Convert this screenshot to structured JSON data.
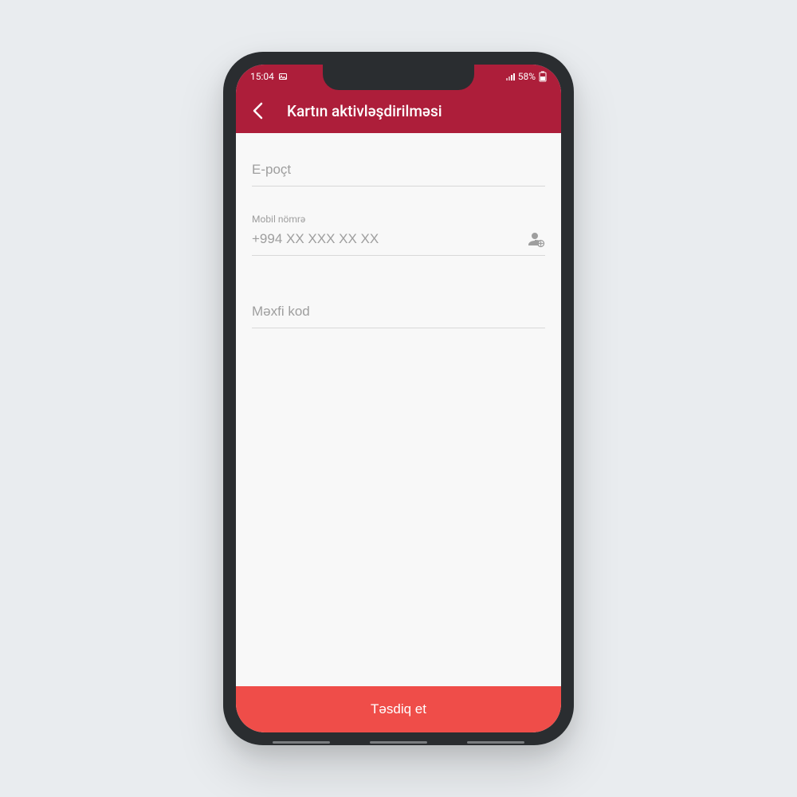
{
  "status_bar": {
    "time": "15:04",
    "battery": "58%"
  },
  "app_bar": {
    "title": "Kartın aktivləşdirilməsi"
  },
  "fields": {
    "email": {
      "placeholder": "E-poçt"
    },
    "phone": {
      "label": "Mobil nömrə",
      "placeholder": "+994 XX XXX XX XX"
    },
    "secret": {
      "placeholder": "Məxfi kod"
    }
  },
  "confirm_button": {
    "label": "Təsdiq et"
  },
  "colors": {
    "header": "#ad1e3a",
    "button": "#ef4d49",
    "background": "#e9ecef"
  }
}
